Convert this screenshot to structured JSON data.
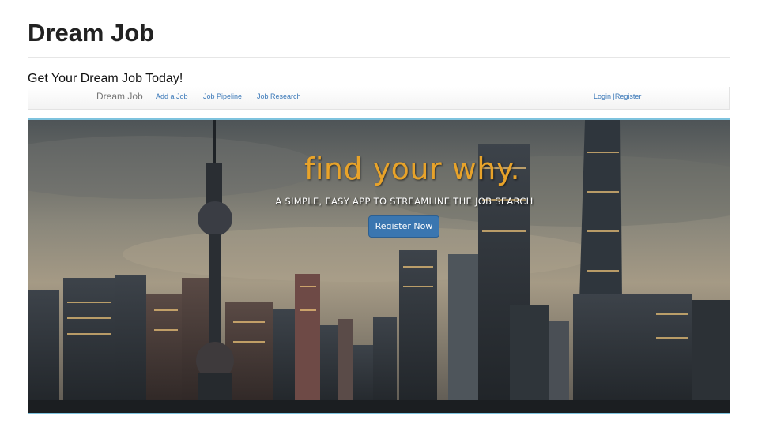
{
  "page": {
    "title": "Dream Job",
    "tagline": "Get Your Dream Job Today!"
  },
  "preview": {
    "navbar": {
      "brand": "Dream Job",
      "links": [
        "Add a Job",
        "Job Pipeline",
        "Job Research"
      ],
      "login": "Login",
      "separator": "|",
      "register": "Register"
    },
    "hero": {
      "headline": "find your why.",
      "subheadline": "A SIMPLE, EASY APP TO STREAMLINE THE JOB SEARCH",
      "cta_label": "Register Now",
      "background": "city-skyline-image"
    }
  },
  "colors": {
    "accent_orange": "#e8a32a",
    "link_blue": "#3a78b8",
    "button_blue": "#3a76b0",
    "hero_border": "#7ec3de"
  }
}
